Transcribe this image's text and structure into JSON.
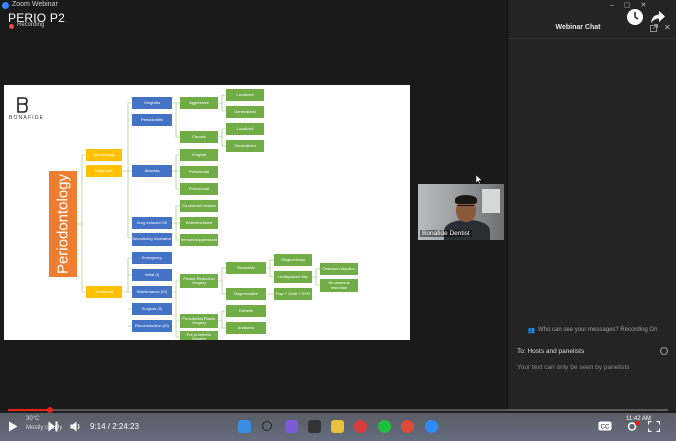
{
  "window": {
    "title": "Zoom Webinar",
    "meeting_title": "PERIO P2",
    "recording_label": "Recording"
  },
  "slide": {
    "brand": "BONAFIDE",
    "root": "Periodontology",
    "nodes": {
      "microbiology": "Microbiology",
      "diagnosis": "Diagnosis",
      "treatment": "Treatment",
      "gingivitis": "Gingivitis",
      "periodontitis": "Periodontitis",
      "abscess": "Abscess",
      "drug_induced": "Drug induced GE",
      "necrotizing": "Necrotizing Ulcerative",
      "aggressive": "Aggressive",
      "chronic": "Chronic",
      "localized_1": "Localized",
      "generalized_1": "Generalized",
      "localized_2": "Localized",
      "generalized_2": "Generalized",
      "gingival": "Gingival",
      "periodontal": "Periodontal",
      "pericoronal": "Pericoronal",
      "ca_channel": "Ca channel blocker",
      "anticonvulsant": "Anticonvulsant",
      "immunosuppressant": "Immunosuppressant",
      "emergency": "Emergency",
      "initial": "Initial (I)",
      "maintenance": "Maintenance (IV)",
      "surgical": "Surgical (II)",
      "reconstruction": "Reconstruction (III)",
      "pocket_reduction": "Pocket Reduction Surgery",
      "periodontal_plastic": "Periodontal Plastic Surgery",
      "pre_prosthetic": "Pre prosthetic Surgery",
      "resective": "Resective",
      "regenerative": "Regenerative",
      "gingivectomy": "Gingivectomy",
      "undisplaced_flap": "Undisplaced flap",
      "flap_graft": "Flap + Graft + GTR",
      "osseous_resection": "Osseous resection",
      "no_osseous": "No osseous resection",
      "esthetic": "Esthetic",
      "anatomic": "Anatomic"
    }
  },
  "presenter": {
    "name": "Bonafide Dentist"
  },
  "chat": {
    "title": "Webinar Chat",
    "privacy_text": "Who can see your messages? Recording On",
    "to_label": "To:",
    "recipients": "Hosts and panelists",
    "input_placeholder": "Your text can only be seen by panelists"
  },
  "player": {
    "current_time": "9:14",
    "total_time": "2:24:23",
    "separator": " / ",
    "progress_fraction": 0.064
  },
  "weather": {
    "temp": "30°C",
    "desc": "Mostly cloudy"
  },
  "clock": {
    "time": "11:42 AM"
  },
  "colors": {
    "accent_red": "#e62117",
    "zoom_blue": "#2d8cff",
    "perio_orange": "#ed7d31"
  }
}
